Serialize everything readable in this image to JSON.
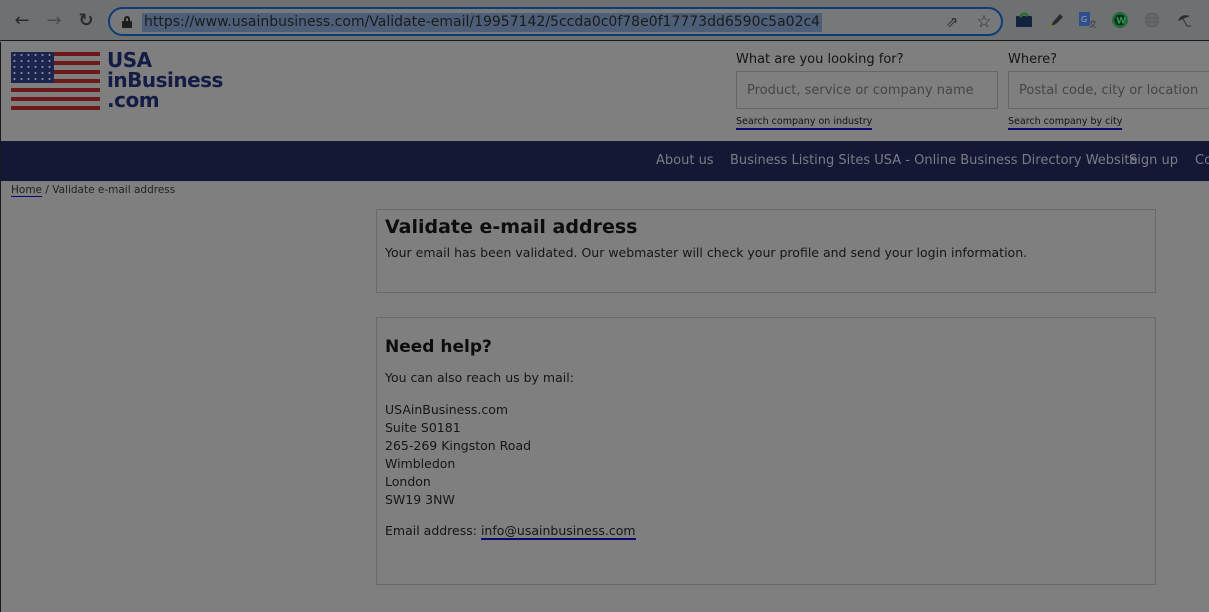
{
  "browser": {
    "back_icon": "←",
    "forward_icon": "→",
    "reload_icon": "↻",
    "url": "https://www.usainbusiness.com/Validate-email/19957142/5ccda0c0f78e0f17773dd6590c5a02c4",
    "share_icon": "⇗",
    "bookmark_icon": "☆",
    "extensions": [
      {
        "name": "folder-extension",
        "color": "#13233d"
      },
      {
        "name": "highlighter-extension",
        "color": "#2b2b2b"
      },
      {
        "name": "translate-extension",
        "color": "#2e4f8f"
      },
      {
        "name": "w-extension",
        "color": "#1f6b3a"
      },
      {
        "name": "globe-extension",
        "color": "#5e5e5e"
      },
      {
        "name": "umbrella-extension",
        "color": "#2b2b2b"
      }
    ]
  },
  "logo": {
    "line1": "USA",
    "line2": "inBusiness",
    "line3": ".com"
  },
  "search": {
    "what_label": "What are you looking for?",
    "what_placeholder": "Product, service or company name",
    "what_link": "Search company on industry",
    "where_label": "Where?",
    "where_placeholder": "Postal code, city or location",
    "where_link": "Search company by city"
  },
  "nav": {
    "items": [
      "About us",
      "Business Listing Sites USA - Online Business Directory Website",
      "Sign up",
      "Co"
    ]
  },
  "breadcrumb": {
    "home": "Home",
    "separator": " / ",
    "current": "Validate e-mail address"
  },
  "validate_panel": {
    "title": "Validate e-mail address",
    "message": "Your email has been validated. Our webmaster will check your profile and send your login information."
  },
  "help_panel": {
    "title": "Need help?",
    "intro": "You can also reach us by mail:",
    "address": [
      "USAinBusiness.com",
      "Suite S0181",
      "265-269 Kingston Road",
      "Wimbledon",
      "London",
      "SW19 3NW"
    ],
    "email_label": "Email address: ",
    "email": "info@usainbusiness.com"
  },
  "colors": {
    "nav_bg": "#141834",
    "overlay_gray": "#7f7f7f",
    "link_underline": "#0a0a6e",
    "omnibox_border": "#0d3d78"
  }
}
